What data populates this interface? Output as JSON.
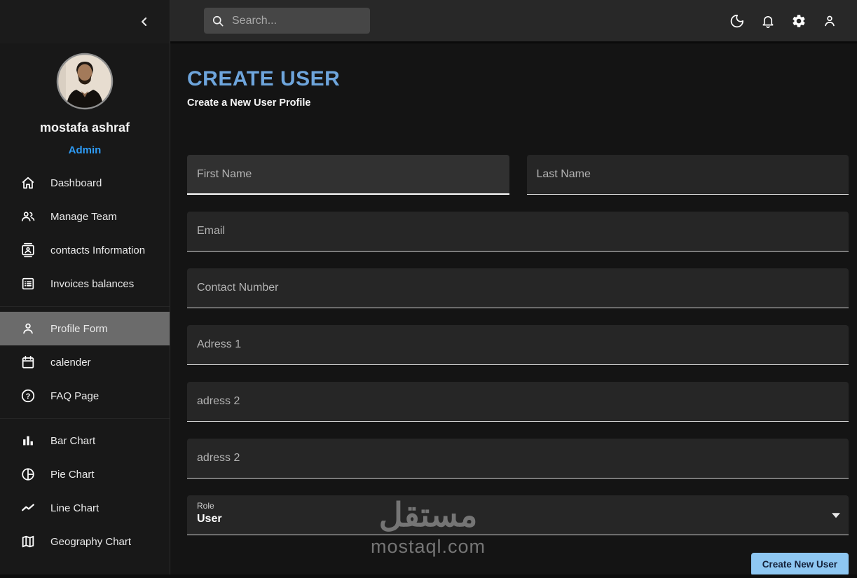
{
  "sidebar": {
    "profile": {
      "name": "mostafa ashraf",
      "role": "Admin"
    },
    "menu": [
      {
        "label": "Dashboard",
        "icon": "home-icon",
        "active": false
      },
      {
        "label": "Manage Team",
        "icon": "people-icon",
        "active": false
      },
      {
        "label": "contacts Information",
        "icon": "contacts-icon",
        "active": false
      },
      {
        "label": "Invoices balances",
        "icon": "invoices-icon",
        "active": false
      },
      {
        "label": "Profile Form",
        "icon": "person-icon",
        "active": true
      },
      {
        "label": "calender",
        "icon": "calendar-icon",
        "active": false
      },
      {
        "label": "FAQ Page",
        "icon": "help-icon",
        "active": false
      },
      {
        "label": "Bar Chart",
        "icon": "bar-chart-icon",
        "active": false
      },
      {
        "label": "Pie Chart",
        "icon": "pie-chart-icon",
        "active": false
      },
      {
        "label": "Line Chart",
        "icon": "line-chart-icon",
        "active": false
      },
      {
        "label": "Geography Chart",
        "icon": "map-icon",
        "active": false
      }
    ]
  },
  "topbar": {
    "search_placeholder": "Search..."
  },
  "header": {
    "title": "CREATE USER",
    "subtitle": "Create a New User Profile"
  },
  "form": {
    "fields": [
      {
        "label": "First Name"
      },
      {
        "label": "Last Name"
      },
      {
        "label": "Email"
      },
      {
        "label": "Contact Number"
      },
      {
        "label": "Adress 1"
      },
      {
        "label": "adress 2"
      },
      {
        "label": "adress 2"
      }
    ],
    "role": {
      "label": "Role",
      "value": "User"
    },
    "submit_label": "Create New User"
  },
  "watermark": {
    "logo": "مستقل",
    "domain": "mostaql.com"
  },
  "colors": {
    "accent_blue": "#2e9bf5",
    "title_blue": "#6ea5dc",
    "button_bg": "#8ec7f2",
    "selected_item_bg": "#6b6b6b",
    "topbar_bg": "#282828",
    "field_bg": "#262626",
    "page_bg": "#141414"
  }
}
